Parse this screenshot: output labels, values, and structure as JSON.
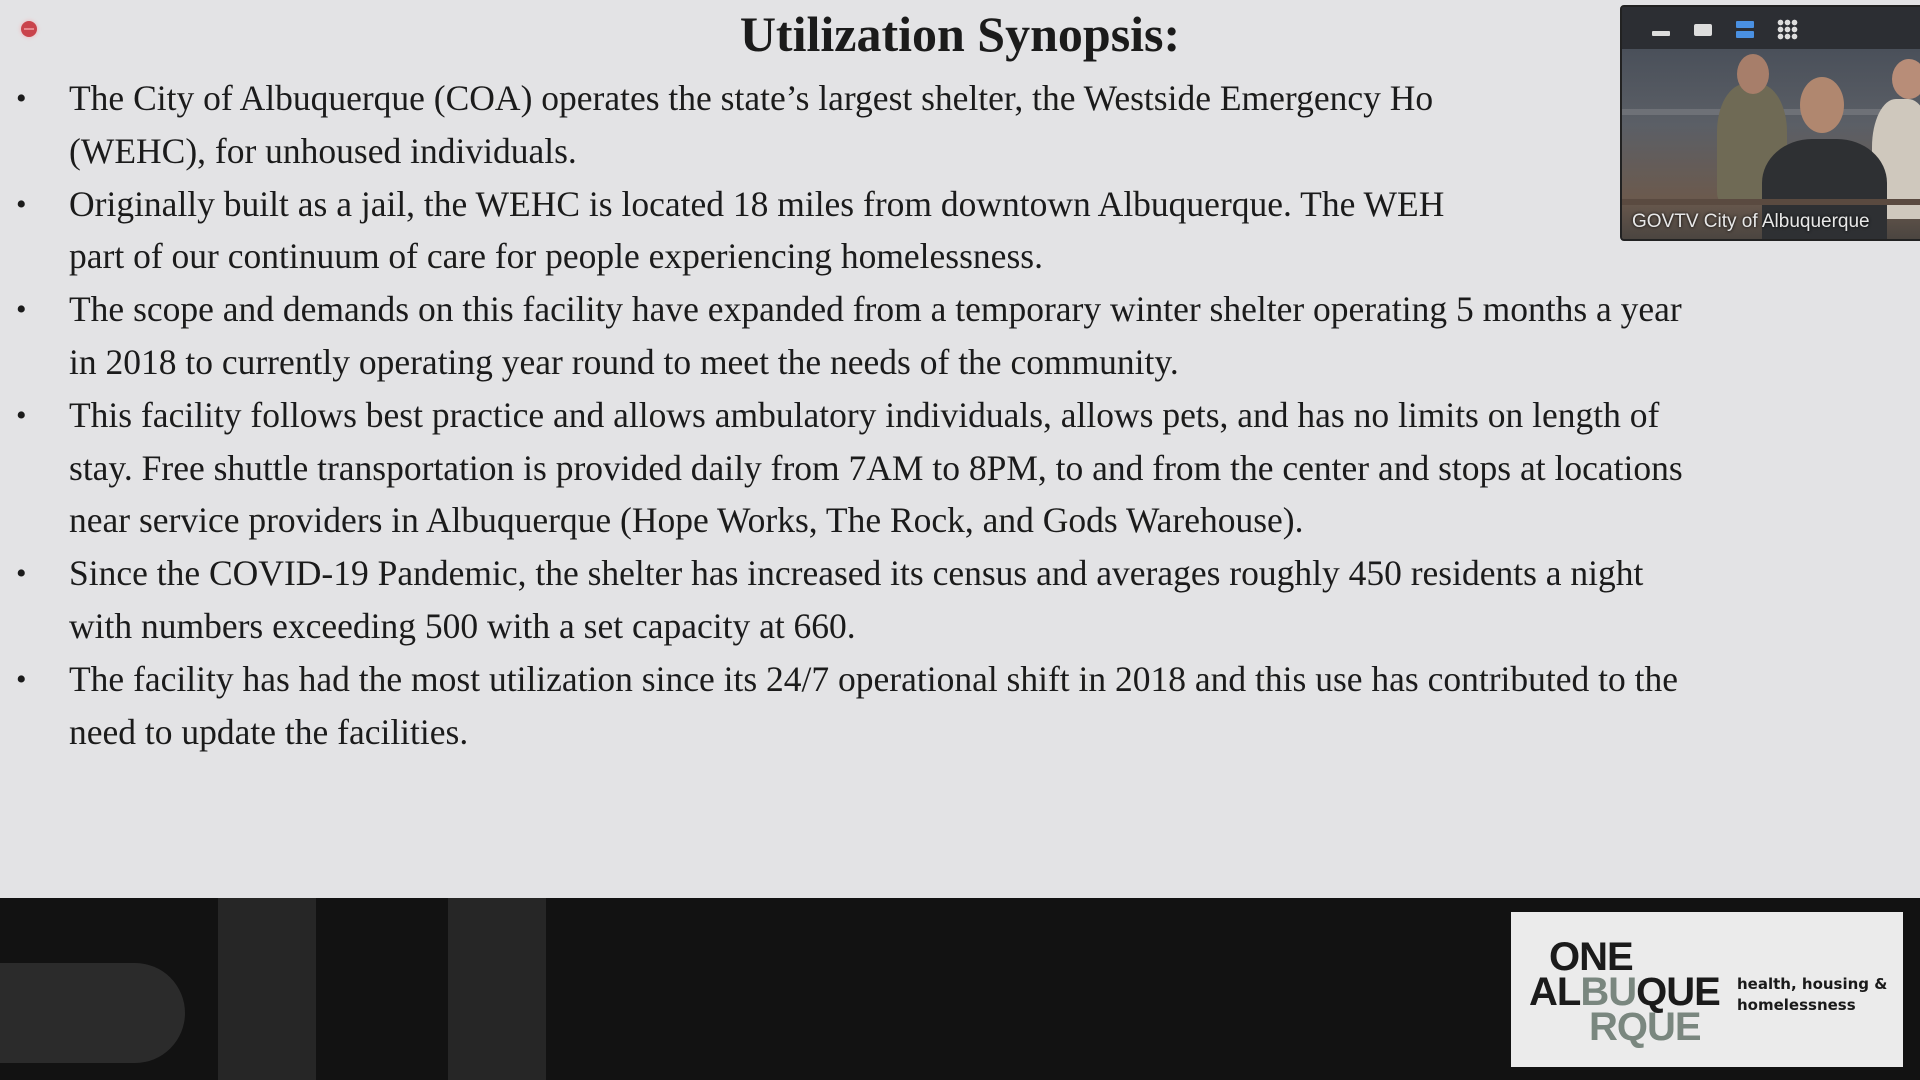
{
  "recording_indicator": "record-icon",
  "slide": {
    "title": "Utilization Synopsis:",
    "bullets": [
      {
        "lines": [
          "The City of Albuquerque (COA) operates the state’s largest shelter, the Westside Emergency Ho",
          "(WEHC), for unhoused individuals."
        ]
      },
      {
        "lines": [
          "Originally built as a jail, the WEHC is located 18 miles from downtown Albuquerque. The WEH",
          "part of our continuum of care for people experiencing homelessness."
        ]
      },
      {
        "lines": [
          "The scope and demands on this facility have expanded from a temporary winter shelter operating 5 months a year",
          "in 2018 to currently operating year round to meet the needs of the community."
        ]
      },
      {
        "lines": [
          "This facility follows best practice and allows ambulatory individuals, allows pets, and has no limits on length of",
          "stay. Free shuttle transportation is provided daily from 7AM to 8PM, to and from the center and stops at locations",
          "near service providers in Albuquerque (Hope Works, The Rock, and Gods Warehouse)."
        ]
      },
      {
        "lines": [
          "Since the COVID-19 Pandemic, the shelter has increased its census and averages roughly 450 residents a night",
          "with numbers exceeding 500 with a set capacity at 660."
        ]
      },
      {
        "lines": [
          "The facility has had the most utilization since its 24/7 operational shift in 2018 and this use has contributed to the",
          "need to update the facilities."
        ]
      }
    ],
    "bullet_char": "•"
  },
  "video_overlay": {
    "caption": "GOVTV City of Albuquerque",
    "controls": [
      "minimize-icon",
      "single-view-icon",
      "stacked-view-icon",
      "grid-view-icon"
    ],
    "active_control_color": "#4a90e2"
  },
  "logo": {
    "line1": "ONE",
    "line2_dark": "AL",
    "line2_green": "BU",
    "line2_dark_end": "QUE",
    "line3": "RQUE",
    "tagline_1": "health, housing &",
    "tagline_2": "homelessness",
    "accent_color": "#7a877f"
  }
}
